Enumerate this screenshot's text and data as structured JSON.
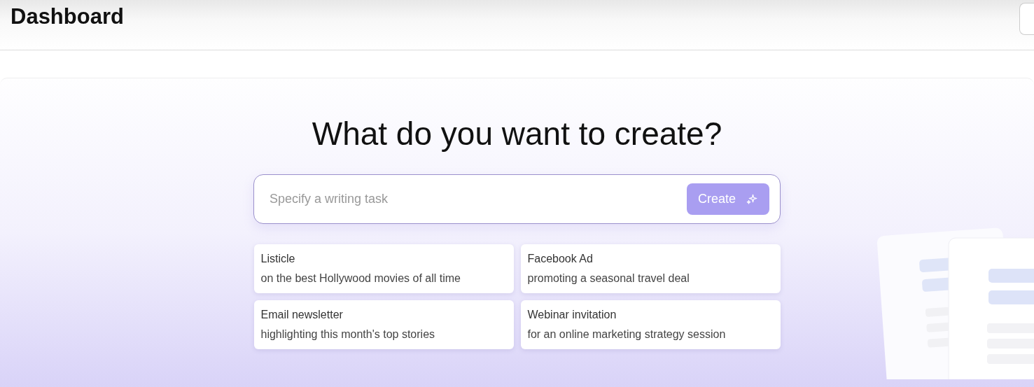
{
  "header": {
    "title": "Dashboard"
  },
  "heading": "What do you want to create?",
  "prompt": {
    "placeholder": "Specify a writing task",
    "button": "Create"
  },
  "suggestions": [
    {
      "title": "Listicle",
      "description": "on the best Hollywood movies of all time"
    },
    {
      "title": "Facebook Ad",
      "description": "promoting a seasonal travel deal"
    },
    {
      "title": "Email newsletter",
      "description": "highlighting this month's top stories"
    },
    {
      "title": "Webinar invitation",
      "description": "for an online marketing strategy session"
    }
  ]
}
